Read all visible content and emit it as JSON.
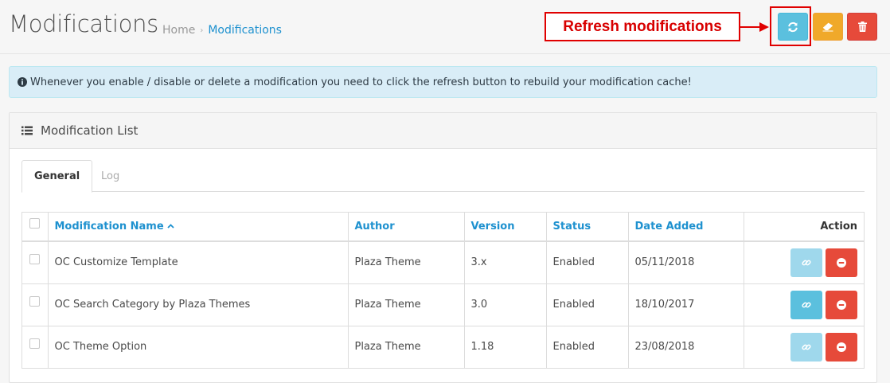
{
  "header": {
    "title": "Modifications",
    "breadcrumb": {
      "home": "Home",
      "separator": "›",
      "current": "Modifications"
    }
  },
  "toolbar": {
    "refresh_icon": "refresh-icon",
    "clear_icon": "eraser-icon",
    "delete_icon": "trash-icon",
    "colors": {
      "refresh": "#5bc0de",
      "clear": "#f0a92a",
      "delete": "#e64a3a"
    }
  },
  "annotation": {
    "callout_text": "Refresh modifications",
    "color": "#e00000"
  },
  "alert": {
    "text": "Whenever you enable / disable or delete a modification you need to click the refresh button to rebuild your modification cache!"
  },
  "panel": {
    "heading": "Modification List",
    "tabs": [
      {
        "label": "General",
        "active": true
      },
      {
        "label": "Log",
        "active": false
      }
    ]
  },
  "table": {
    "columns": {
      "name": "Modification Name",
      "author": "Author",
      "version": "Version",
      "status": "Status",
      "date_added": "Date Added",
      "action": "Action"
    },
    "rows": [
      {
        "name": "OC Customize Template",
        "author": "Plaza Theme",
        "version": "3.x",
        "status": "Enabled",
        "date_added": "05/11/2018",
        "link_enabled": false
      },
      {
        "name": "OC Search Category by Plaza Themes",
        "author": "Plaza Theme",
        "version": "3.0",
        "status": "Enabled",
        "date_added": "18/10/2017",
        "link_enabled": true
      },
      {
        "name": "OC Theme Option",
        "author": "Plaza Theme",
        "version": "1.18",
        "status": "Enabled",
        "date_added": "23/08/2018",
        "link_enabled": false
      }
    ]
  }
}
